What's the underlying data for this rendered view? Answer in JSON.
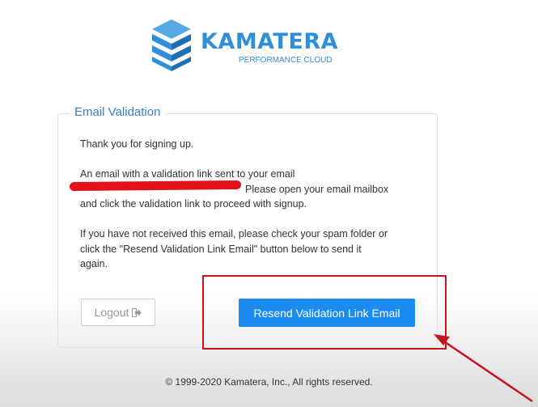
{
  "brand": {
    "name": "KAMATERA",
    "tagline": "PERFORMANCE CLOUD",
    "logo_icon": "stacked-cube-logo",
    "color": "#2f8fd8"
  },
  "panel": {
    "title": "Email Validation",
    "thanks": "Thank you for signing up.",
    "validation_line1": "An email with a validation link sent to your email",
    "validation_line2": "Please open your email mailbox",
    "validation_line3": "and click the validation link to proceed with signup.",
    "spam_line1": "If you have not received this email, please check your spam folder or",
    "spam_line2": "click the \"Resend Validation Link Email\" button below to send it",
    "spam_line3": "again."
  },
  "buttons": {
    "logout_label": "Logout",
    "logout_icon": "sign-out-icon",
    "resend_label": "Resend Validation Link Email",
    "resend_color": "#1d8cf0"
  },
  "annotations": {
    "highlight_color": "#c8141b",
    "redaction_color": "#e3111a"
  },
  "footer": {
    "copyright": "© 1999-2020 Kamatera, Inc., All rights reserved."
  }
}
